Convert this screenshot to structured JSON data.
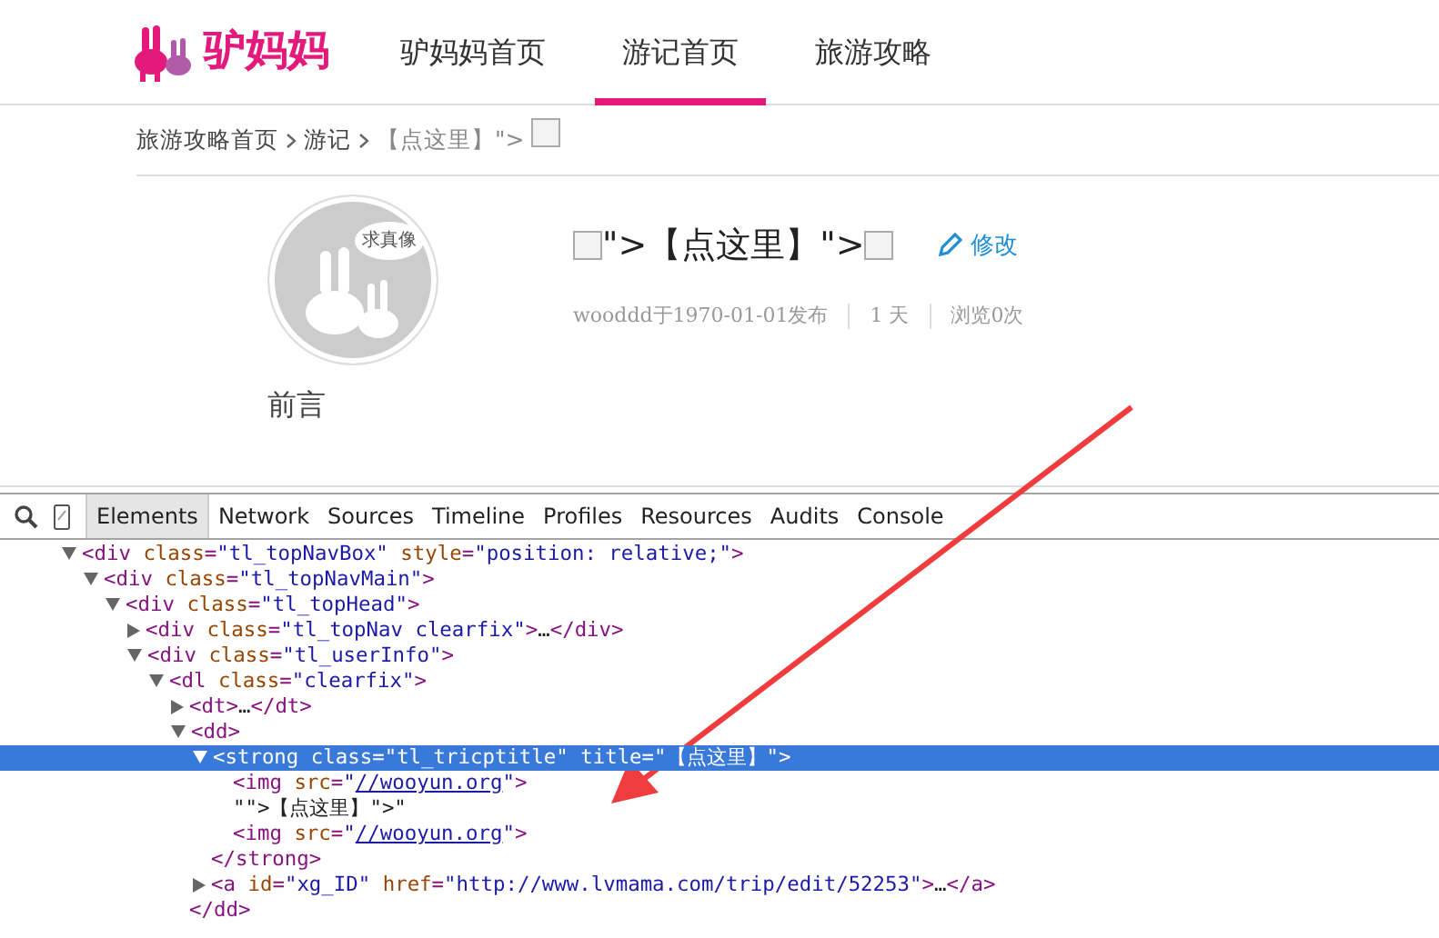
{
  "site": {
    "logo_text": "驴妈妈",
    "nav": [
      {
        "label": "驴妈妈首页",
        "selected": false
      },
      {
        "label": "游记首页",
        "selected": true
      },
      {
        "label": "旅游攻略",
        "selected": false
      }
    ],
    "breadcrumb": [
      "旅游攻略首页",
      "游记",
      "【点这里】\">"
    ],
    "avatar_bubble": "求真像",
    "section_label": "前言",
    "title": "\">【点这里】\">",
    "edit_link": "修改",
    "meta": [
      "wooddd于1970-01-01发布",
      "1 天",
      "浏览0次"
    ]
  },
  "devtools": {
    "tabs": [
      {
        "label": "Elements",
        "selected": true
      },
      {
        "label": "Network",
        "selected": false
      },
      {
        "label": "Sources",
        "selected": false
      },
      {
        "label": "Timeline",
        "selected": false
      },
      {
        "label": "Profiles",
        "selected": false
      },
      {
        "label": "Resources",
        "selected": false
      },
      {
        "label": "Audits",
        "selected": false
      },
      {
        "label": "Console",
        "selected": false
      }
    ],
    "tree": [
      {
        "markup": "<div class=\"tl_topNavBox\" style=\"position: relative;\">",
        "expanded": true,
        "selected": false,
        "children": [
          {
            "markup": "<div class=\"tl_topNavMain\">",
            "expanded": true,
            "selected": false,
            "children": [
              {
                "markup": "<div class=\"tl_topHead\">",
                "expanded": true,
                "selected": false,
                "children": [
                  {
                    "markup": "<div class=\"tl_topNav clearfix\">…</div>",
                    "expanded": false,
                    "selected": false
                  },
                  {
                    "markup": "<div class=\"tl_userInfo\">",
                    "expanded": true,
                    "selected": false,
                    "children": [
                      {
                        "markup": "<dl class=\"clearfix\">",
                        "expanded": true,
                        "selected": false,
                        "children": [
                          {
                            "markup": "<dt>…</dt>",
                            "expanded": false,
                            "selected": false
                          },
                          {
                            "markup": "<dd>",
                            "expanded": true,
                            "selected": false,
                            "closing": "</dd>",
                            "children": [
                              {
                                "markup": "<strong class=\"tl_tricptitle\" title=\"【点这里】\">",
                                "expanded": true,
                                "selected": true,
                                "closing": "</strong>",
                                "children": [
                                  {
                                    "markup": "<img src=\"//wooyun.org\">",
                                    "selected": false
                                  },
                                  {
                                    "markup": "\"\">【点这里】\">\"",
                                    "selected": false
                                  },
                                  {
                                    "markup": "<img src=\"//wooyun.org\">",
                                    "selected": false
                                  }
                                ]
                              },
                              {
                                "markup": "<a id=\"xg_ID\" href=\"http://www.lvmama.com/trip/edit/52253\">…</a>",
                                "expanded": false,
                                "selected": false
                              }
                            ]
                          }
                        ]
                      }
                    ]
                  }
                ]
              }
            ]
          }
        ]
      }
    ]
  }
}
